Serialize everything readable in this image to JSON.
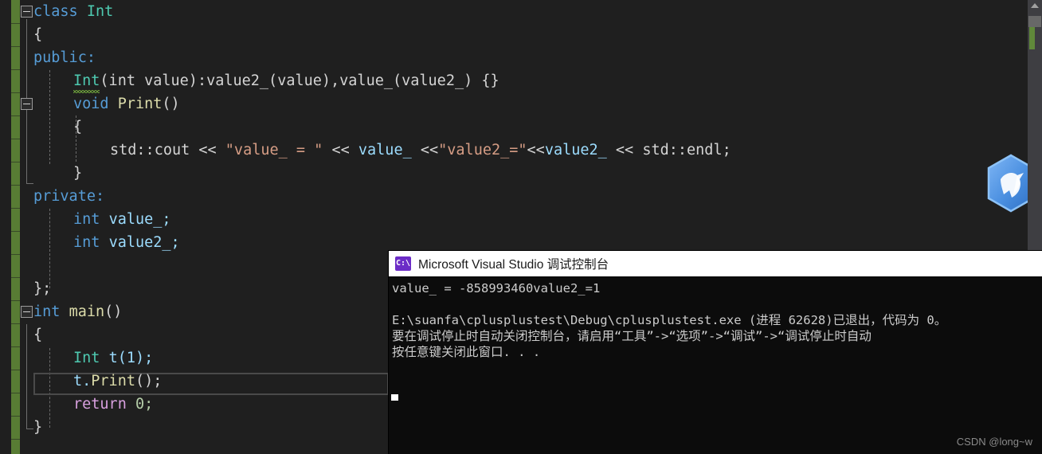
{
  "app": {
    "name": "visual-studio-editor",
    "background": "#1f1f1f"
  },
  "editor": {
    "language": "C++",
    "change_bar_color": "#587c34",
    "lines": [
      {
        "indent": 0,
        "text": "class Int"
      },
      {
        "indent": 1,
        "text": "{"
      },
      {
        "indent": 1,
        "text": "public:"
      },
      {
        "indent": 2,
        "text": "Int(int value):value2_(value),value_(value2_) {}"
      },
      {
        "indent": 2,
        "text": "void Print()"
      },
      {
        "indent": 2,
        "text": "{"
      },
      {
        "indent": 3,
        "text": "std::cout << \"value_ = \" << value_ <<\"value2_=\"<<value2_ << std::endl;"
      },
      {
        "indent": 2,
        "text": "}"
      },
      {
        "indent": 1,
        "text": "private:"
      },
      {
        "indent": 2,
        "text": "int value_;"
      },
      {
        "indent": 2,
        "text": "int value2_;"
      },
      {
        "indent": 0,
        "text": ""
      },
      {
        "indent": 1,
        "text": "};"
      },
      {
        "indent": 0,
        "text": "int main()"
      },
      {
        "indent": 1,
        "text": "{"
      },
      {
        "indent": 2,
        "text": "Int t(1);"
      },
      {
        "indent": 2,
        "text": "t.Print();"
      },
      {
        "indent": 2,
        "text": "return 0;"
      },
      {
        "indent": 1,
        "text": "}"
      }
    ],
    "tokens": {
      "kw_class": "class",
      "type_int_class": "Int",
      "brace_open": "{",
      "kw_public": "public:",
      "ctor_name": "Int",
      "ctor_params": "(int value)",
      "ctor_init": ":value2_(value),value_(value2_) {}",
      "kw_void": "void",
      "fn_print": "Print",
      "fn_print_parens": "()",
      "cout_prefix": "std::cout << ",
      "cout_str1": "\"value_ = \"",
      "cout_mid1": " << ",
      "cout_value": "value_",
      "cout_mid2": " <<",
      "cout_str2": "\"value2_=\"",
      "cout_mid3": "<<",
      "cout_value2": "value2_",
      "cout_mid4": " << ",
      "cout_endl": "std::endl",
      "semicolon": ";",
      "brace_close": "}",
      "kw_private": "private:",
      "kw_int": "int",
      "field_value": "value_;",
      "field_value2": "value2_;",
      "class_end": "};",
      "main_ret": "int",
      "main_name": "main",
      "main_parens": "()",
      "var_type": "Int",
      "var_decl": "t(1);",
      "call_obj": "t.",
      "call_fn": "Print",
      "call_tail": "();",
      "kw_return": "return",
      "ret_value": "0;"
    },
    "error_squiggle_on": "Int",
    "current_line": "t.Print();"
  },
  "scrollbar": {
    "up_arrow": "scroll-up-arrow",
    "thumb": "scroll-thumb",
    "change_marker_color": "#60893a"
  },
  "branding": {
    "badge_icon": "bird-hexagon-icon"
  },
  "console": {
    "title": "Microsoft Visual Studio 调试控制台",
    "icon": "command-prompt-icon",
    "icon_label": "C:\\",
    "output": [
      "value_ = -858993460value2_=1",
      "",
      "E:\\suanfa\\cplusplustest\\Debug\\cplusplustest.exe (进程 62628)已退出，代码为 0。",
      "要在调试停止时自动关闭控制台，请启用“工具”->“选项”->“调试”->“调试停止时自动",
      "按任意键关闭此窗口. . ."
    ],
    "cursor": "block-cursor"
  },
  "watermark": {
    "text": "CSDN @long~w"
  }
}
